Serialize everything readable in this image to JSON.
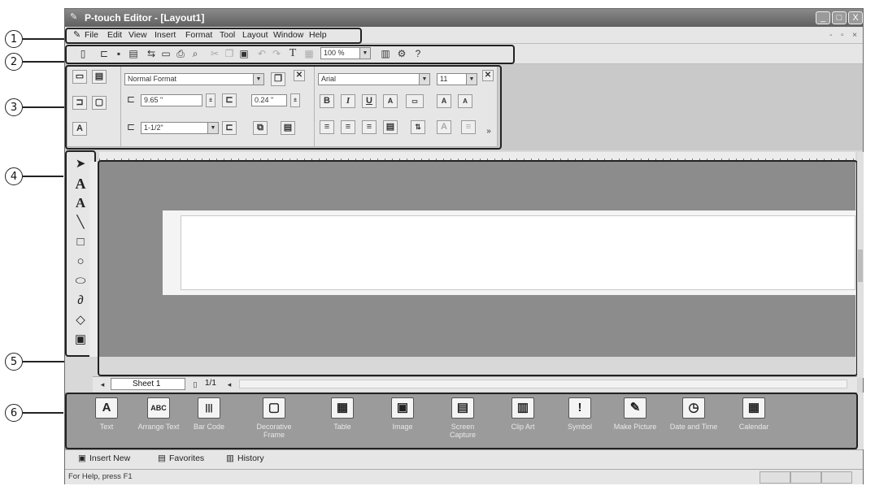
{
  "window": {
    "title": "P-touch Editor - [Layout1]",
    "minimize": "_",
    "maximize": "□",
    "close": "X",
    "mdi_controls": [
      "-",
      "▫",
      "×"
    ]
  },
  "callouts": [
    "1",
    "2",
    "3",
    "4",
    "5",
    "6"
  ],
  "menubar": {
    "items": [
      "File",
      "Edit",
      "View",
      "Insert",
      "Format",
      "Tool",
      "Layout",
      "Window",
      "Help"
    ]
  },
  "toolbar": {
    "zoom": "100 %",
    "text_tool": "T"
  },
  "props": {
    "format": "Normal Format",
    "width": "9.65 \"",
    "height": "0.24 \"",
    "length": "1-1/2\"",
    "font": "Arial",
    "size": "11",
    "bold": "B",
    "italic": "I",
    "underline": "U",
    "more": "»"
  },
  "sheetbar": {
    "sheet_tab": "Sheet 1",
    "page": "1/1"
  },
  "palette": {
    "items": [
      {
        "label": "Text",
        "icon": "A"
      },
      {
        "label": "Arrange Text",
        "icon": "ABC"
      },
      {
        "label": "Bar Code",
        "icon": "|||"
      },
      {
        "label": "Decorative Frame",
        "icon": "▢"
      },
      {
        "label": "Table",
        "icon": "▦"
      },
      {
        "label": "Image",
        "icon": "▣"
      },
      {
        "label": "Screen Capture",
        "icon": "▤"
      },
      {
        "label": "Clip Art",
        "icon": "▥"
      },
      {
        "label": "Symbol",
        "icon": "!"
      },
      {
        "label": "Make Picture",
        "icon": "✎"
      },
      {
        "label": "Date and Time",
        "icon": "◷"
      },
      {
        "label": "Calendar",
        "icon": "▦"
      }
    ]
  },
  "palette_tabs": [
    "Insert New",
    "Favorites",
    "History"
  ],
  "status": "For Help, press F1"
}
